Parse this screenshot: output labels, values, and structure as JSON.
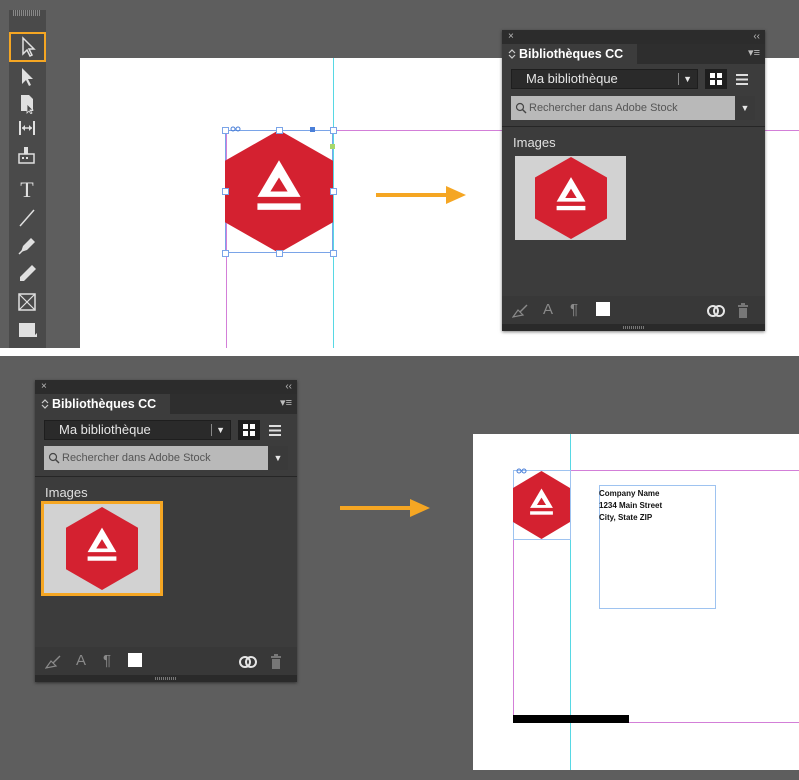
{
  "panel": {
    "close": "×",
    "collapse": "‹‹",
    "tab_title": "Bibliothèques CC",
    "tab_icon": "updown-chevron-icon",
    "menu": "▾≡",
    "library": "Ma bibliothèque",
    "search_placeholder": "Rechercher dans Adobe Stock",
    "images_label": "Images",
    "footer_icons": [
      "brush-icon",
      "character-style-icon",
      "paragraph-style-icon",
      "color-swatch-icon",
      "cc-sync-icon",
      "trash-icon"
    ]
  },
  "toolbar": {
    "tools": [
      "selection-tool-icon",
      "direct-selection-tool-icon",
      "page-tool-icon",
      "gap-tool-icon",
      "content-collector-icon",
      "type-tool-icon",
      "line-tool-icon",
      "pen-tool-icon",
      "pencil-tool-icon",
      "rectangle-frame-tool-icon",
      "rectangle-tool-icon"
    ],
    "type_glyph": "T"
  },
  "document": {
    "address_lines": [
      "Company Name",
      "1234 Main Street",
      "City, State ZIP"
    ]
  },
  "colors": {
    "accent_orange": "#f5a623",
    "logo_red": "#d42130",
    "panel_bg": "#3c3c3c",
    "guide_cyan": "#57d8e4",
    "margin_magenta": "#d37fd8"
  }
}
